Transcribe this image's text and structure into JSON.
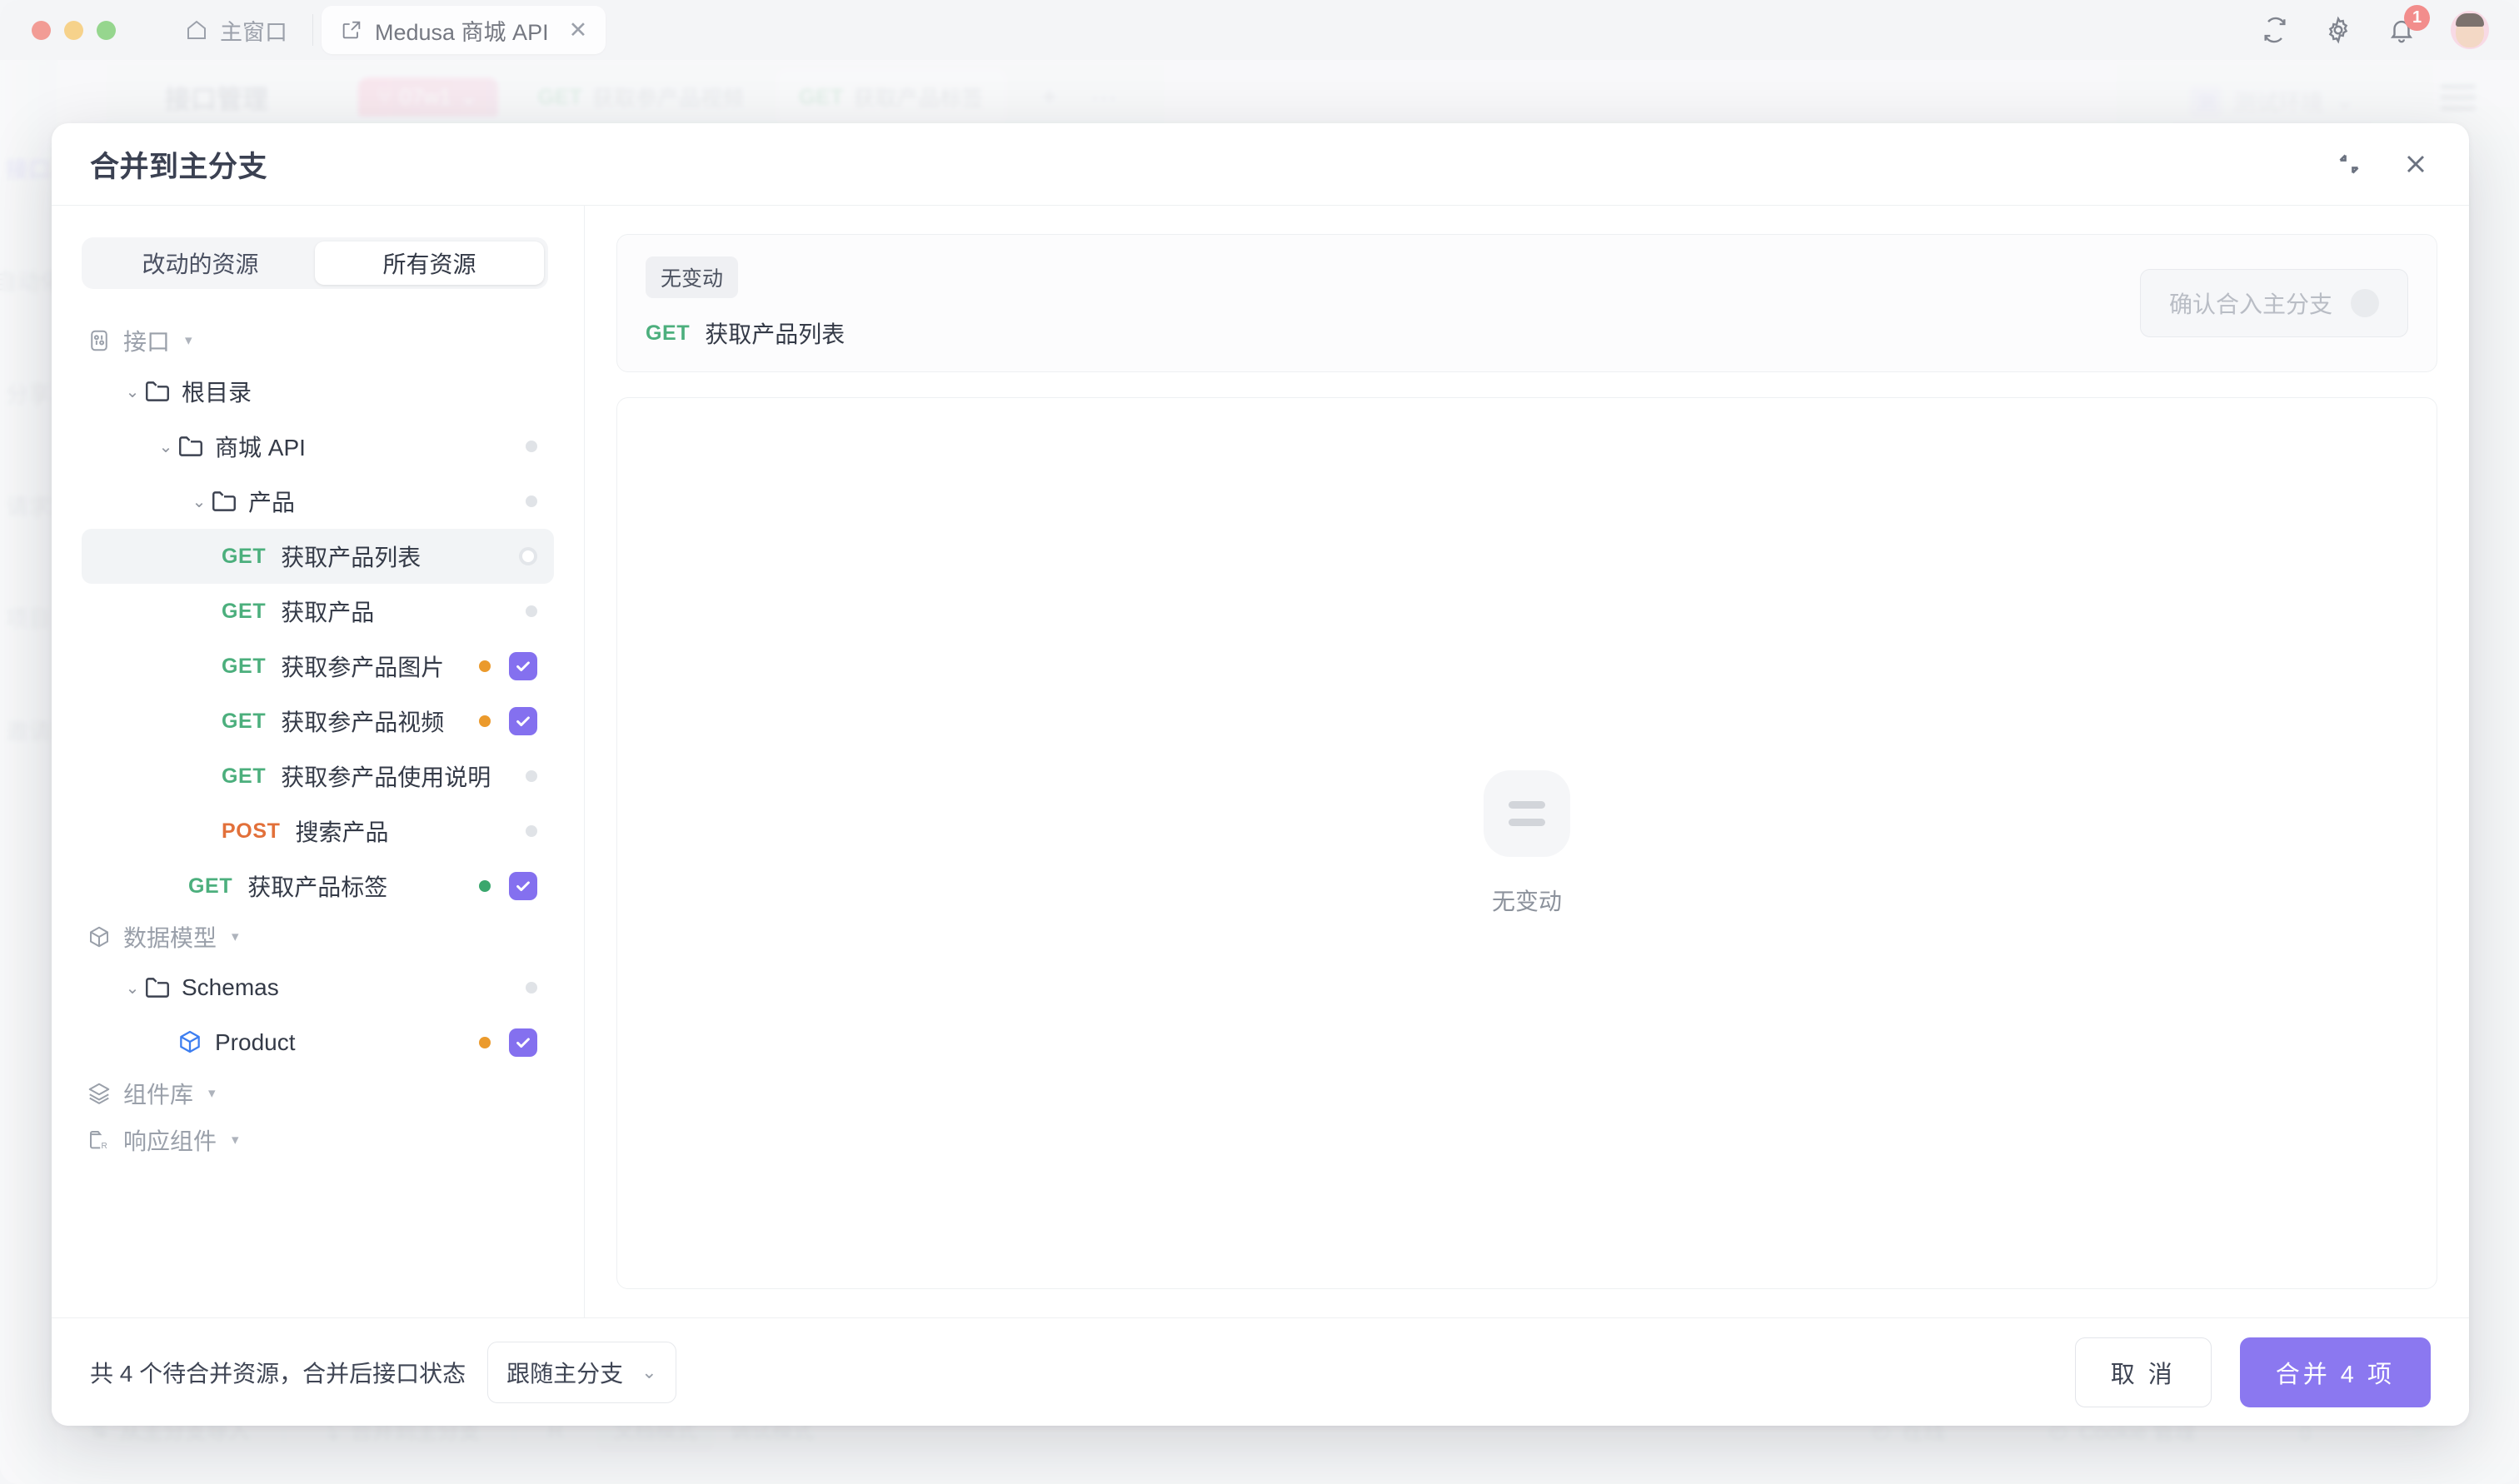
{
  "window": {
    "home_tab": "主窗口",
    "app_tab": "Medusa 商城 API",
    "tab_close": "✕",
    "notification_count": "1"
  },
  "background": {
    "rail": [
      {
        "label": "接口",
        "active": true
      },
      {
        "label": "自动化",
        "active": false
      },
      {
        "label": "分享",
        "active": false
      },
      {
        "label": "请求",
        "active": false
      },
      {
        "label": "项目",
        "active": false
      },
      {
        "label": "邀请",
        "active": false
      }
    ],
    "page_title": "接口管理",
    "branch": "07w1",
    "tabs": [
      {
        "method": "GET",
        "label": "获取参产品视频"
      },
      {
        "method": "GET",
        "label": "获取产品标签"
      }
    ],
    "add_tab": "+",
    "more_tabs": "···",
    "env_short": "测",
    "env": "测试环境",
    "bottom": [
      {
        "label": "从主分支导入"
      },
      {
        "label": "合并到主分支"
      }
    ],
    "bottom_prefix": "R",
    "bottom_modes": [
      "文档模式",
      "调试模式"
    ],
    "bottom_right": [
      "在线",
      "Cookie 管理"
    ]
  },
  "modal": {
    "title": "合并到主分支",
    "collapse_icon": "collapse-icon",
    "close_icon": "close-icon",
    "segments": [
      {
        "label": "改动的资源",
        "active": false
      },
      {
        "label": "所有资源",
        "active": true
      }
    ],
    "tree": [
      {
        "kind": "group",
        "label": "接口",
        "icon": "api-icon",
        "depth": 0
      },
      {
        "kind": "folder",
        "label": "根目录",
        "depth": 1,
        "expanded": true,
        "state": "none"
      },
      {
        "kind": "folder",
        "label": "商城 API",
        "depth": 2,
        "expanded": true,
        "state": "gray"
      },
      {
        "kind": "folder",
        "label": "产品",
        "depth": 3,
        "expanded": true,
        "state": "gray"
      },
      {
        "kind": "api",
        "method": "GET",
        "label": "获取产品列表",
        "depth": 4,
        "state": "ring",
        "selected": true,
        "checked": false
      },
      {
        "kind": "api",
        "method": "GET",
        "label": "获取产品",
        "depth": 4,
        "state": "gray",
        "checked": false
      },
      {
        "kind": "api",
        "method": "GET",
        "label": "获取参产品图片",
        "depth": 4,
        "state": "orange",
        "checked": true
      },
      {
        "kind": "api",
        "method": "GET",
        "label": "获取参产品视频",
        "depth": 4,
        "state": "orange",
        "checked": true
      },
      {
        "kind": "api",
        "method": "GET",
        "label": "获取参产品使用说明",
        "depth": 4,
        "state": "gray",
        "checked": false
      },
      {
        "kind": "api",
        "method": "POST",
        "label": "搜索产品",
        "depth": 4,
        "state": "gray",
        "checked": false
      },
      {
        "kind": "api",
        "method": "GET",
        "label": "获取产品标签",
        "depth": 3,
        "state": "green",
        "checked": true
      },
      {
        "kind": "group",
        "label": "数据模型",
        "icon": "cube-icon",
        "depth": 0
      },
      {
        "kind": "folder",
        "label": "Schemas",
        "depth": 1,
        "expanded": true,
        "state": "gray"
      },
      {
        "kind": "schema",
        "label": "Product",
        "depth": 2,
        "state": "orange",
        "checked": true
      },
      {
        "kind": "group",
        "label": "组件库",
        "icon": "layers-icon",
        "depth": 0
      },
      {
        "kind": "group",
        "label": "响应组件",
        "icon": "response-icon",
        "depth": 0
      }
    ],
    "diff": {
      "tag": "无变动",
      "method": "GET",
      "name": "获取产品列表",
      "confirm_label": "确认合入主分支",
      "empty_text": "无变动"
    },
    "footer": {
      "summary": "共 4 个待合并资源，合并后接口状态",
      "select_value": "跟随主分支",
      "cancel": "取 消",
      "merge": "合并 4 项"
    }
  },
  "colors": {
    "accent": "#8b78f0",
    "get": "#4caf7d",
    "post": "#e2703a",
    "dot_orange": "#eb9a2c",
    "dot_green": "#3aa76d",
    "dot_gray": "#e0e3e7"
  }
}
